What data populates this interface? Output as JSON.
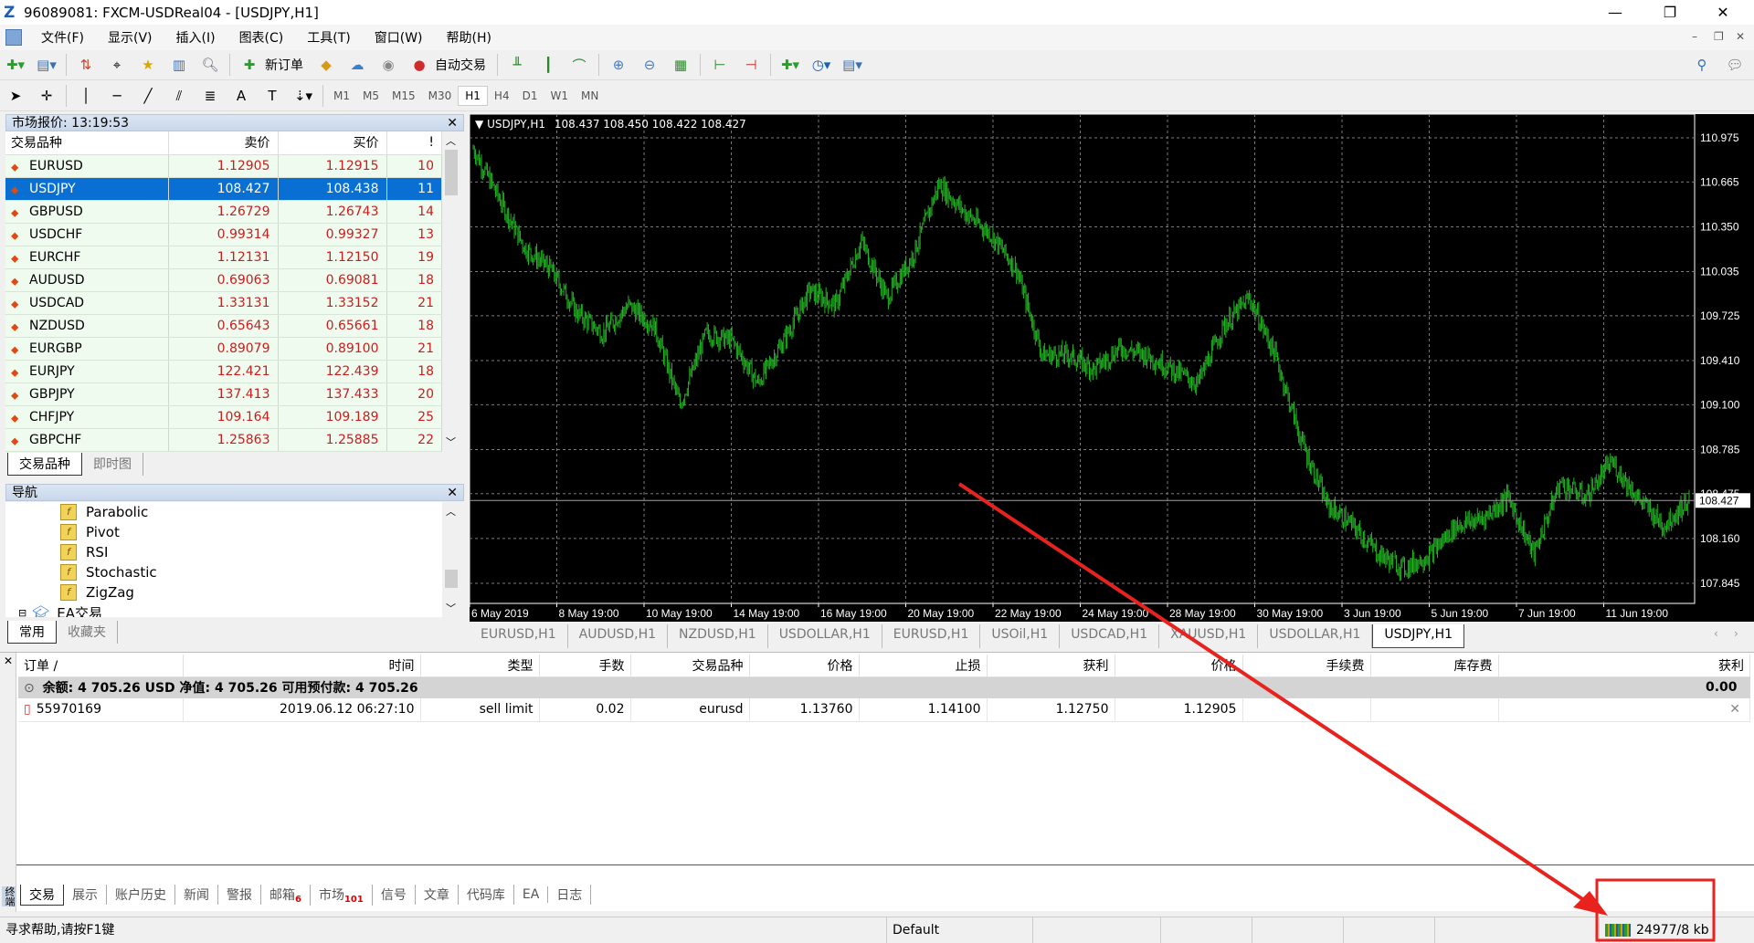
{
  "window": {
    "title": "96089081: FXCM-USDReal04 - [USDJPY,H1]",
    "controls": [
      "—",
      "❐",
      "✕"
    ]
  },
  "menu": [
    "文件(F)",
    "显示(V)",
    "插入(I)",
    "图表(C)",
    "工具(T)",
    "窗口(W)",
    "帮助(H)"
  ],
  "toolbar": {
    "new_order": "新订单",
    "auto_trading": "自动交易",
    "timeframes": [
      "M1",
      "M5",
      "M15",
      "M30",
      "H1",
      "H4",
      "D1",
      "W1",
      "MN"
    ],
    "active_timeframe": "H1"
  },
  "market_watch": {
    "title": "市场报价: 13:19:53",
    "columns": [
      "交易品种",
      "卖价",
      "买价",
      "!"
    ],
    "rows": [
      {
        "symbol": "EURUSD",
        "bid": "1.12905",
        "ask": "1.12915",
        "spread": "10"
      },
      {
        "symbol": "USDJPY",
        "bid": "108.427",
        "ask": "108.438",
        "spread": "11",
        "selected": true
      },
      {
        "symbol": "GBPUSD",
        "bid": "1.26729",
        "ask": "1.26743",
        "spread": "14"
      },
      {
        "symbol": "USDCHF",
        "bid": "0.99314",
        "ask": "0.99327",
        "spread": "13"
      },
      {
        "symbol": "EURCHF",
        "bid": "1.12131",
        "ask": "1.12150",
        "spread": "19"
      },
      {
        "symbol": "AUDUSD",
        "bid": "0.69063",
        "ask": "0.69081",
        "spread": "18"
      },
      {
        "symbol": "USDCAD",
        "bid": "1.33131",
        "ask": "1.33152",
        "spread": "21"
      },
      {
        "symbol": "NZDUSD",
        "bid": "0.65643",
        "ask": "0.65661",
        "spread": "18"
      },
      {
        "symbol": "EURGBP",
        "bid": "0.89079",
        "ask": "0.89100",
        "spread": "21"
      },
      {
        "symbol": "EURJPY",
        "bid": "122.421",
        "ask": "122.439",
        "spread": "18"
      },
      {
        "symbol": "GBPJPY",
        "bid": "137.413",
        "ask": "137.433",
        "spread": "20"
      },
      {
        "symbol": "CHFJPY",
        "bid": "109.164",
        "ask": "109.189",
        "spread": "25"
      },
      {
        "symbol": "GBPCHF",
        "bid": "1.25863",
        "ask": "1.25885",
        "spread": "22"
      }
    ],
    "tabs": [
      "交易品种",
      "即时图"
    ]
  },
  "navigator": {
    "title": "导航",
    "items": [
      "Parabolic",
      "Pivot",
      "RSI",
      "Stochastic",
      "ZigZag"
    ],
    "group": "EA交易",
    "tabs": [
      "常用",
      "收藏夹"
    ]
  },
  "chart_data": {
    "type": "ohlc",
    "symbol_label": "USDJPY,H1",
    "ohlc_label": "108.437 108.450 108.422 108.427",
    "current_price": "108.427",
    "ylim": [
      107.7,
      111.1
    ],
    "yticks": [
      "110.975",
      "110.665",
      "110.350",
      "110.035",
      "109.725",
      "109.410",
      "109.100",
      "108.785",
      "108.475",
      "108.160",
      "107.845"
    ],
    "xticks": [
      "6 May 2019",
      "8 May 19:00",
      "10 May 19:00",
      "14 May 19:00",
      "16 May 19:00",
      "20 May 19:00",
      "22 May 19:00",
      "24 May 19:00",
      "28 May 19:00",
      "30 May 19:00",
      "3 Jun 19:00",
      "5 Jun 19:00",
      "7 Jun 19:00",
      "11 Jun 19:00"
    ],
    "approx_closes": [
      110.9,
      110.55,
      110.2,
      110.05,
      109.75,
      109.6,
      109.8,
      109.65,
      109.1,
      109.6,
      109.55,
      109.25,
      109.55,
      109.9,
      109.8,
      110.25,
      109.85,
      110.15,
      110.65,
      110.45,
      110.3,
      110.05,
      109.45,
      109.45,
      109.35,
      109.5,
      109.45,
      109.35,
      109.25,
      109.65,
      109.85,
      109.45,
      108.85,
      108.4,
      108.25,
      108.05,
      107.95,
      108.05,
      108.25,
      108.3,
      108.45,
      108.05,
      108.55,
      108.45,
      108.7,
      108.45,
      108.25,
      108.43
    ],
    "grid": true,
    "bar_color": "#22b422",
    "background": "#000000"
  },
  "chart_tabs": [
    "EURUSD,H1",
    "AUDUSD,H1",
    "NZDUSD,H1",
    "USDOLLAR,H1",
    "EURUSD,H1",
    "USOil,H1",
    "USDCAD,H1",
    "XAUUSD,H1",
    "USDOLLAR,H1",
    "USDJPY,H1"
  ],
  "active_chart_tab": "USDJPY,H1",
  "terminal": {
    "columns": [
      "订单 /",
      "时间",
      "类型",
      "手数",
      "交易品种",
      "价格",
      "止损",
      "获利",
      "价格",
      "手续费",
      "库存费",
      "获利"
    ],
    "balance_line": "余额: 4 705.26 USD  净值: 4 705.26  可用预付款: 4 705.26",
    "balance_profit": "0.00",
    "orders": [
      {
        "ticket": "55970169",
        "time": "2019.06.12 06:27:10",
        "type": "sell limit",
        "lots": "0.02",
        "symbol": "eurusd",
        "price": "1.13760",
        "sl": "1.14100",
        "tp": "1.12750",
        "cur_price": "1.12905"
      }
    ],
    "tabs": [
      {
        "label": "交易"
      },
      {
        "label": "展示"
      },
      {
        "label": "账户历史"
      },
      {
        "label": "新闻"
      },
      {
        "label": "警报"
      },
      {
        "label": "邮箱",
        "badge": "6"
      },
      {
        "label": "市场",
        "badge": "101"
      },
      {
        "label": "信号"
      },
      {
        "label": "文章"
      },
      {
        "label": "代码库"
      },
      {
        "label": "EA"
      },
      {
        "label": "日志"
      }
    ],
    "side_label": "终端"
  },
  "status": {
    "help": "寻求帮助,请按F1键",
    "profile": "Default",
    "traffic": "24977/8 kb"
  },
  "annotation_color": "#e8231e"
}
